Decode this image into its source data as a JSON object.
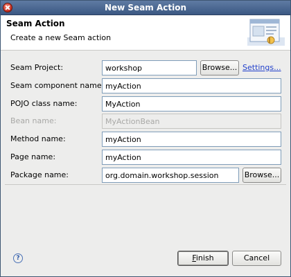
{
  "window": {
    "title": "New Seam Action"
  },
  "banner": {
    "title": "Seam Action",
    "description": "Create a new Seam action"
  },
  "form": {
    "seam_project": {
      "label": "Seam Project:",
      "value": "workshop",
      "browse": "Browse...",
      "settings": "Settings..."
    },
    "component_name": {
      "label": "Seam component name:",
      "value": "myAction"
    },
    "pojo_class": {
      "label": "POJO class name:",
      "value": "MyAction"
    },
    "bean_name": {
      "label": "Bean name:",
      "value": "MyActionBean",
      "disabled": true
    },
    "method_name": {
      "label": "Method name:",
      "value": "myAction"
    },
    "page_name": {
      "label": "Page name:",
      "value": "myAction"
    },
    "package_name": {
      "label": "Package name:",
      "value": "org.domain.workshop.session",
      "browse": "Browse..."
    }
  },
  "footer": {
    "help_glyph": "?",
    "finish_mnemonic": "F",
    "finish_rest": "inish",
    "cancel": "Cancel"
  },
  "icons": {
    "close": "close-icon",
    "banner": "wizard-banner-icon",
    "help": "help-icon"
  }
}
